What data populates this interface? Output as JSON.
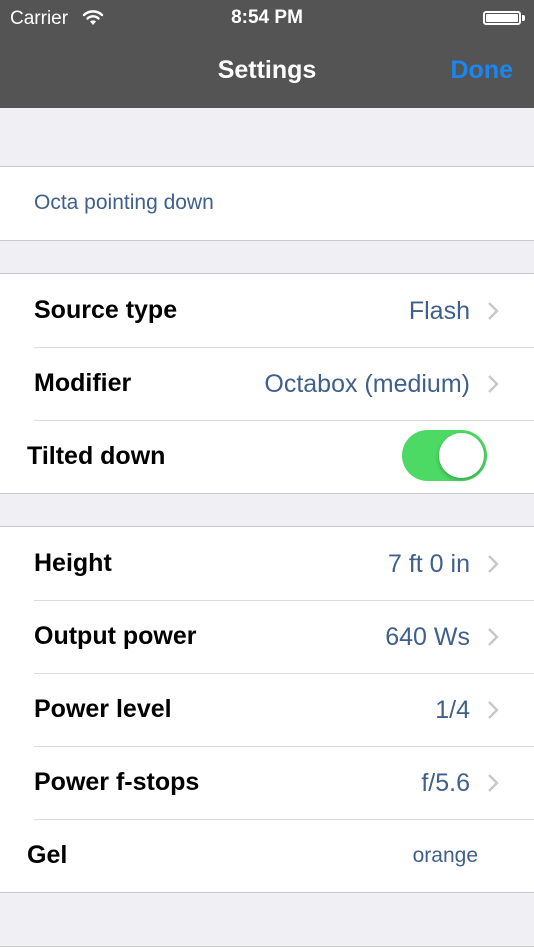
{
  "status_bar": {
    "carrier": "Carrier",
    "time": "8:54 PM",
    "wifi_icon": "wifi-icon",
    "battery_icon": "battery-icon"
  },
  "nav": {
    "title": "Settings",
    "done_label": "Done",
    "done_color": "#1a86f2"
  },
  "name_field": {
    "value": "Octa pointing down"
  },
  "source_group": {
    "source_type": {
      "label": "Source type",
      "value": "Flash"
    },
    "modifier": {
      "label": "Modifier",
      "value": "Octabox (medium)"
    },
    "tilted_down": {
      "label": "Tilted down",
      "on": true
    }
  },
  "power_group": {
    "height": {
      "label": "Height",
      "value": "7 ft 0 in"
    },
    "output_power": {
      "label": "Output power",
      "value": "640 Ws"
    },
    "power_level": {
      "label": "Power level",
      "value": "1/4"
    },
    "power_fstops": {
      "label": "Power f-stops",
      "value": "f/5.6"
    },
    "gel": {
      "label": "Gel",
      "value": "orange"
    }
  },
  "colors": {
    "nav_background": "#545454",
    "value_text": "#3f5f8c",
    "toggle_on": "#4cd964",
    "page_background": "#efeff4"
  }
}
